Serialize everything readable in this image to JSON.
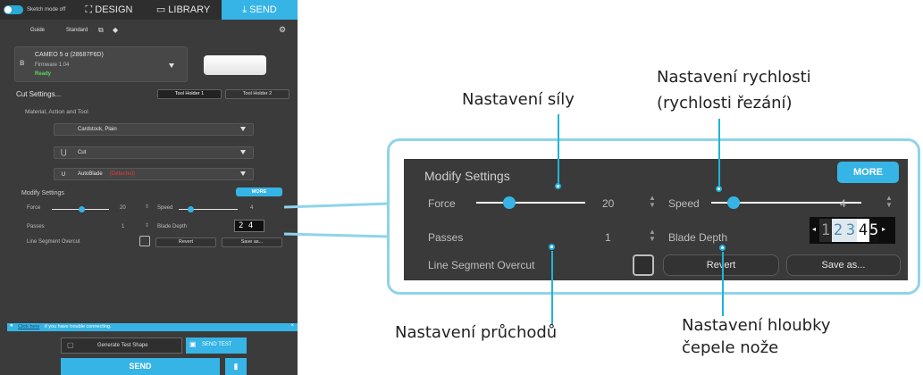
{
  "app": {
    "topbar": {
      "toggle_label": "Sketch mode off",
      "tabs": [
        {
          "label": "DESIGN",
          "icon": "design-icon"
        },
        {
          "label": "LIBRARY",
          "icon": "folder-icon"
        },
        {
          "label": "SEND",
          "icon": "send-icon"
        }
      ]
    },
    "subbar": {
      "guide": "Guide",
      "standard": "Standard"
    },
    "device": {
      "name": "CAMEO 5 α (28687F6D)",
      "firmware": "Firmware 1.04",
      "status": "Ready"
    },
    "cut_settings": {
      "title": "Cut Settings...",
      "tool_holder_1": "Tool Holder 1",
      "tool_holder_2": "Tool Holder 2",
      "material_action_tool": "Material, Action and Tool",
      "material": "Cardstock, Plain",
      "action": "Cut",
      "tool": "AutoBlade",
      "tool_status": "(Detected)"
    },
    "modify": {
      "title": "Modify Settings",
      "more": "MORE",
      "force": "Force",
      "force_value": "20",
      "speed": "Speed",
      "speed_value": "4",
      "passes": "Passes",
      "passes_value": "1",
      "blade_depth": "Blade Depth",
      "line_segment": "Line Segment Overcut",
      "revert": "Revert",
      "save_as": "Save as..."
    },
    "info_bar": {
      "link": "Click here",
      "text": "if you have trouble connecting."
    },
    "bottom": {
      "generate_test": "Generate Test Shape",
      "send_test": "SEND TEST",
      "send": "SEND"
    }
  },
  "zoom_panel": {
    "title": "Modify Settings",
    "more": "MORE",
    "force": "Force",
    "force_value": "20",
    "force_level": 0.3,
    "speed": "Speed",
    "speed_value": "4",
    "speed_level": 0.15,
    "passes": "Passes",
    "passes_value": "1",
    "blade_depth": "Blade Depth",
    "blade_digits": [
      "1",
      "2",
      "3",
      "4",
      "5"
    ],
    "line_segment": "Line Segment Overcut",
    "revert": "Revert",
    "save_as": "Save as..."
  },
  "annotations": {
    "force": "Nastavení síly",
    "speed_line1": "Nastavení rychlosti",
    "speed_line2": "(rychlosti řezání)",
    "passes": "Nastavení průchodů",
    "depth_line1": "Nastavení hloubky",
    "depth_line2": "čepele nože"
  },
  "colors": {
    "accent": "#36b4e5",
    "callout_border": "#8fd4ea",
    "panel_bg": "#3a3a3a",
    "pointer": "#1fb3dc"
  }
}
